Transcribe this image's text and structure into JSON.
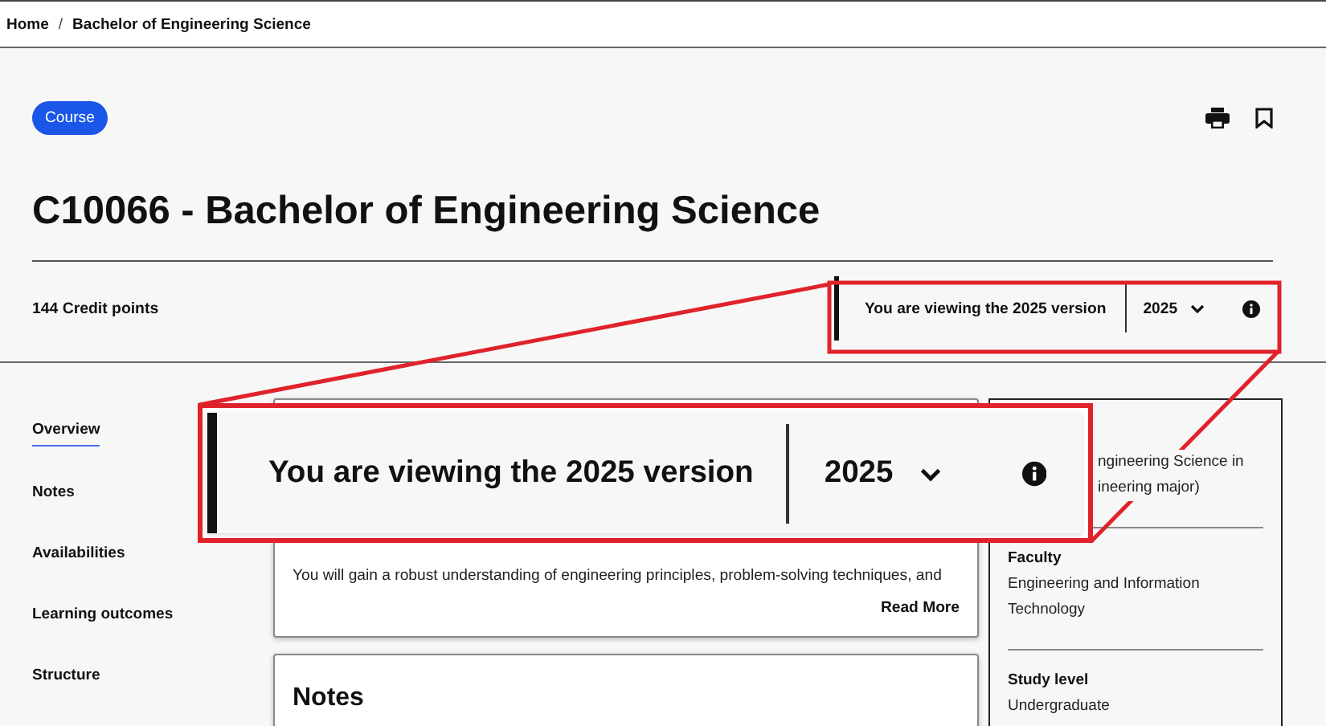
{
  "breadcrumb_separator": "/",
  "breadcrumb": [
    {
      "label": "Home"
    },
    {
      "label": "Bachelor of Engineering Science"
    }
  ],
  "badge": "Course",
  "title": "C10066 - Bachelor of Engineering Science",
  "credit_points": "144 Credit points",
  "version_bar": {
    "text": "You are viewing the 2025 version",
    "year": "2025"
  },
  "nav": [
    {
      "label": "Overview",
      "selected": true
    },
    {
      "label": "Notes",
      "selected": false
    },
    {
      "label": "Availabilities",
      "selected": false
    },
    {
      "label": "Learning outcomes",
      "selected": false
    },
    {
      "label": "Structure",
      "selected": false
    }
  ],
  "overview_card": {
    "text": "You will gain a robust understanding of engineering principles, problem-solving techniques, and",
    "link": "Read More"
  },
  "notes_card": {
    "title": "Notes"
  },
  "sidebar": {
    "fragment_lines": [
      "ngineering Science in",
      "ineering major)"
    ],
    "fields": [
      {
        "label": "Faculty",
        "value": "Engineering and Information Technology"
      },
      {
        "label": "Study level",
        "value": "Undergraduate"
      }
    ]
  },
  "callout": {
    "text": "You are viewing the 2025 version",
    "year": "2025"
  }
}
